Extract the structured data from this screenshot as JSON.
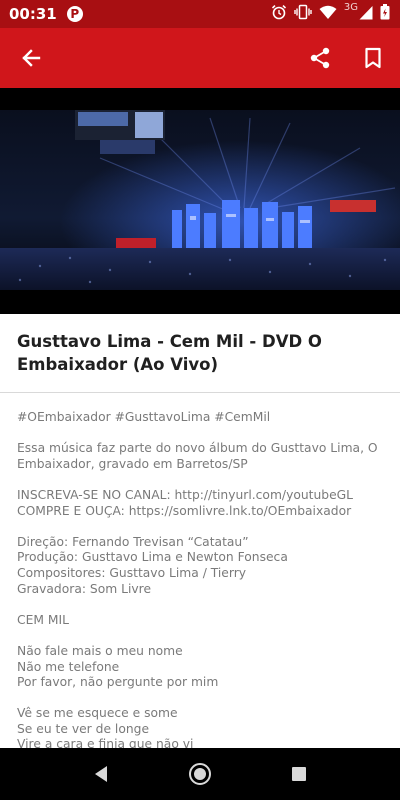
{
  "status_bar": {
    "time": "00:31",
    "notification_icon": "p-icon",
    "network_type": "3G",
    "icons": [
      "alarm-icon",
      "vibrate-icon",
      "wifi-icon",
      "signal-icon",
      "battery-icon"
    ]
  },
  "app_bar": {
    "color": "#d0161b",
    "icons": [
      "back-arrow-icon",
      "share-icon",
      "bookmark-icon"
    ]
  },
  "video": {
    "thumbnail": "concert-stage-thumbnail"
  },
  "title": "Gusttavo Lima - Cem Mil - DVD O Embaixador (Ao Vivo)",
  "description": {
    "lines": [
      "#OEmbaixador #GusttavoLima #CemMil",
      "",
      "Essa música faz parte do novo álbum do Gusttavo Lima, O",
      "Embaixador, gravado em Barretos/SP",
      "",
      "INSCREVA-SE NO CANAL: http://tinyurl.com/youtubeGL",
      "COMPRE E OUÇA: https://somlivre.lnk.to/OEmbaixador",
      "",
      "Direção: Fernando Trevisan “Catatau”",
      "Produção: Gusttavo Lima e Newton Fonseca",
      "Compositores: Gusttavo Lima / Tierry",
      "Gravadora: Som Livre",
      "",
      "CEM MIL",
      "",
      "Não fale mais o meu nome",
      "Não me telefone",
      "Por favor, não pergunte por mim",
      "",
      "Vê se me esquece e some",
      "Se eu te ver de longe",
      "Vire a cara e finja que não vi"
    ]
  },
  "nav_bar": {
    "icons": [
      "nav-back-icon",
      "nav-home-icon",
      "nav-recents-icon"
    ]
  }
}
